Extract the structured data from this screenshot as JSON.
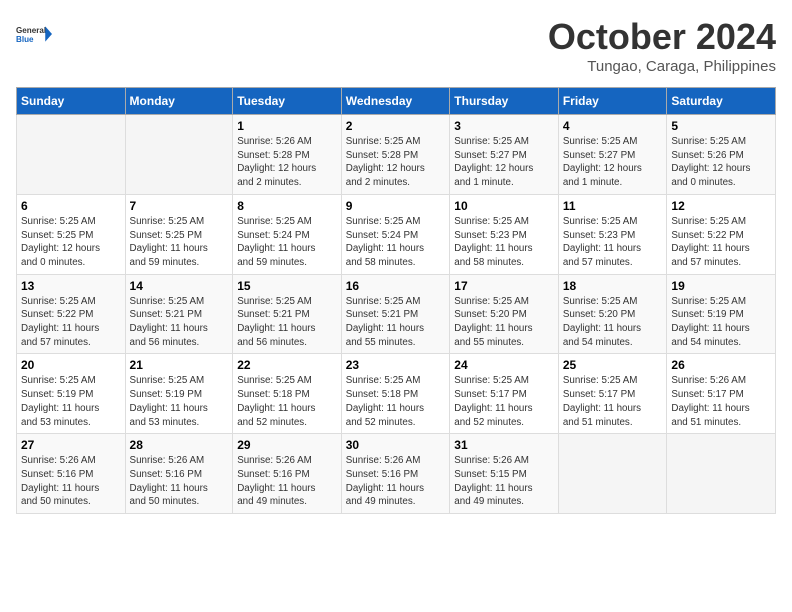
{
  "logo": {
    "line1": "General",
    "line2": "Blue"
  },
  "title": "October 2024",
  "location": "Tungao, Caraga, Philippines",
  "weekdays": [
    "Sunday",
    "Monday",
    "Tuesday",
    "Wednesday",
    "Thursday",
    "Friday",
    "Saturday"
  ],
  "weeks": [
    [
      {
        "day": "",
        "info": ""
      },
      {
        "day": "",
        "info": ""
      },
      {
        "day": "1",
        "info": "Sunrise: 5:26 AM\nSunset: 5:28 PM\nDaylight: 12 hours\nand 2 minutes."
      },
      {
        "day": "2",
        "info": "Sunrise: 5:25 AM\nSunset: 5:28 PM\nDaylight: 12 hours\nand 2 minutes."
      },
      {
        "day": "3",
        "info": "Sunrise: 5:25 AM\nSunset: 5:27 PM\nDaylight: 12 hours\nand 1 minute."
      },
      {
        "day": "4",
        "info": "Sunrise: 5:25 AM\nSunset: 5:27 PM\nDaylight: 12 hours\nand 1 minute."
      },
      {
        "day": "5",
        "info": "Sunrise: 5:25 AM\nSunset: 5:26 PM\nDaylight: 12 hours\nand 0 minutes."
      }
    ],
    [
      {
        "day": "6",
        "info": "Sunrise: 5:25 AM\nSunset: 5:25 PM\nDaylight: 12 hours\nand 0 minutes."
      },
      {
        "day": "7",
        "info": "Sunrise: 5:25 AM\nSunset: 5:25 PM\nDaylight: 11 hours\nand 59 minutes."
      },
      {
        "day": "8",
        "info": "Sunrise: 5:25 AM\nSunset: 5:24 PM\nDaylight: 11 hours\nand 59 minutes."
      },
      {
        "day": "9",
        "info": "Sunrise: 5:25 AM\nSunset: 5:24 PM\nDaylight: 11 hours\nand 58 minutes."
      },
      {
        "day": "10",
        "info": "Sunrise: 5:25 AM\nSunset: 5:23 PM\nDaylight: 11 hours\nand 58 minutes."
      },
      {
        "day": "11",
        "info": "Sunrise: 5:25 AM\nSunset: 5:23 PM\nDaylight: 11 hours\nand 57 minutes."
      },
      {
        "day": "12",
        "info": "Sunrise: 5:25 AM\nSunset: 5:22 PM\nDaylight: 11 hours\nand 57 minutes."
      }
    ],
    [
      {
        "day": "13",
        "info": "Sunrise: 5:25 AM\nSunset: 5:22 PM\nDaylight: 11 hours\nand 57 minutes."
      },
      {
        "day": "14",
        "info": "Sunrise: 5:25 AM\nSunset: 5:21 PM\nDaylight: 11 hours\nand 56 minutes."
      },
      {
        "day": "15",
        "info": "Sunrise: 5:25 AM\nSunset: 5:21 PM\nDaylight: 11 hours\nand 56 minutes."
      },
      {
        "day": "16",
        "info": "Sunrise: 5:25 AM\nSunset: 5:21 PM\nDaylight: 11 hours\nand 55 minutes."
      },
      {
        "day": "17",
        "info": "Sunrise: 5:25 AM\nSunset: 5:20 PM\nDaylight: 11 hours\nand 55 minutes."
      },
      {
        "day": "18",
        "info": "Sunrise: 5:25 AM\nSunset: 5:20 PM\nDaylight: 11 hours\nand 54 minutes."
      },
      {
        "day": "19",
        "info": "Sunrise: 5:25 AM\nSunset: 5:19 PM\nDaylight: 11 hours\nand 54 minutes."
      }
    ],
    [
      {
        "day": "20",
        "info": "Sunrise: 5:25 AM\nSunset: 5:19 PM\nDaylight: 11 hours\nand 53 minutes."
      },
      {
        "day": "21",
        "info": "Sunrise: 5:25 AM\nSunset: 5:19 PM\nDaylight: 11 hours\nand 53 minutes."
      },
      {
        "day": "22",
        "info": "Sunrise: 5:25 AM\nSunset: 5:18 PM\nDaylight: 11 hours\nand 52 minutes."
      },
      {
        "day": "23",
        "info": "Sunrise: 5:25 AM\nSunset: 5:18 PM\nDaylight: 11 hours\nand 52 minutes."
      },
      {
        "day": "24",
        "info": "Sunrise: 5:25 AM\nSunset: 5:17 PM\nDaylight: 11 hours\nand 52 minutes."
      },
      {
        "day": "25",
        "info": "Sunrise: 5:25 AM\nSunset: 5:17 PM\nDaylight: 11 hours\nand 51 minutes."
      },
      {
        "day": "26",
        "info": "Sunrise: 5:26 AM\nSunset: 5:17 PM\nDaylight: 11 hours\nand 51 minutes."
      }
    ],
    [
      {
        "day": "27",
        "info": "Sunrise: 5:26 AM\nSunset: 5:16 PM\nDaylight: 11 hours\nand 50 minutes."
      },
      {
        "day": "28",
        "info": "Sunrise: 5:26 AM\nSunset: 5:16 PM\nDaylight: 11 hours\nand 50 minutes."
      },
      {
        "day": "29",
        "info": "Sunrise: 5:26 AM\nSunset: 5:16 PM\nDaylight: 11 hours\nand 49 minutes."
      },
      {
        "day": "30",
        "info": "Sunrise: 5:26 AM\nSunset: 5:16 PM\nDaylight: 11 hours\nand 49 minutes."
      },
      {
        "day": "31",
        "info": "Sunrise: 5:26 AM\nSunset: 5:15 PM\nDaylight: 11 hours\nand 49 minutes."
      },
      {
        "day": "",
        "info": ""
      },
      {
        "day": "",
        "info": ""
      }
    ]
  ]
}
